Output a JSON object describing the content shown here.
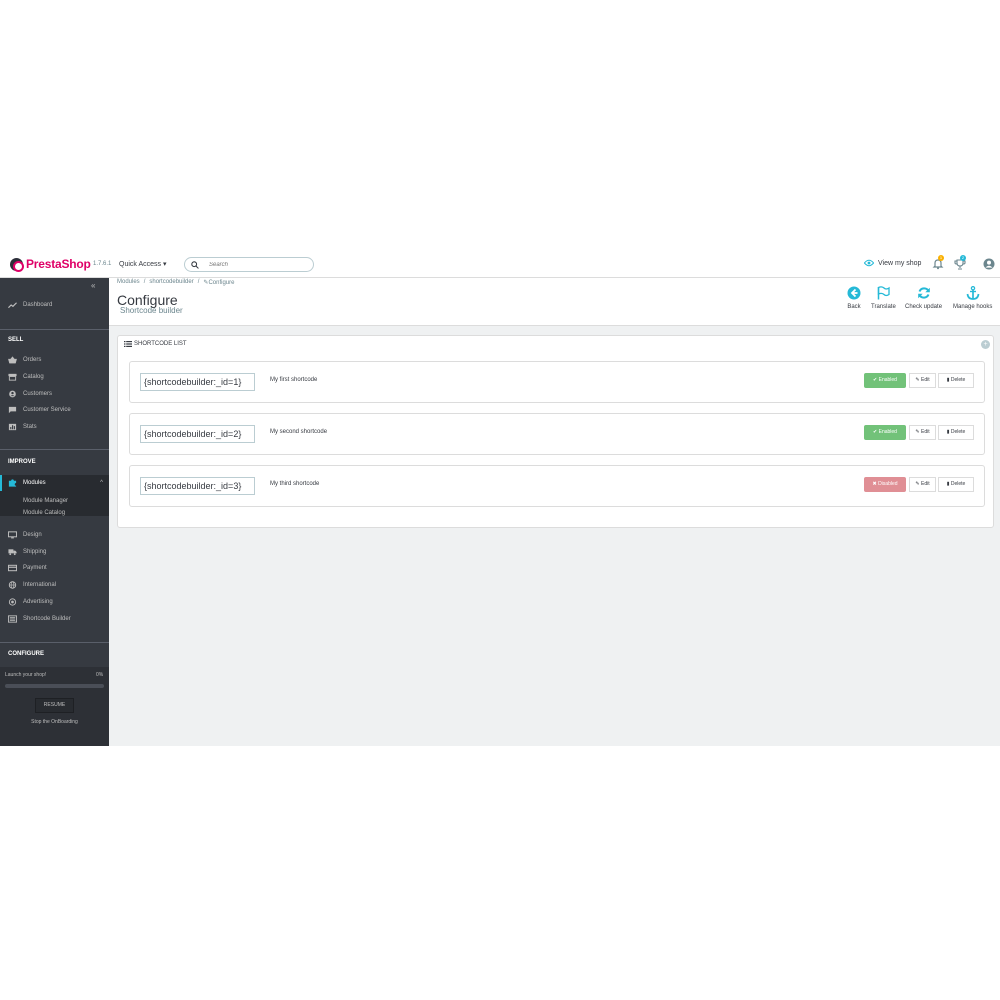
{
  "header": {
    "logo_text": "PrestaShop",
    "version": "1.7.6.1",
    "quick_access": "Quick Access",
    "search_placeholder": "Search",
    "view_shop": "View my shop",
    "notifications_count": "1",
    "orders_count": "2"
  },
  "sidebar": {
    "dashboard": "Dashboard",
    "sections": {
      "sell": "SELL",
      "improve": "IMPROVE",
      "configure": "CONFIGURE"
    },
    "sell_items": [
      "Orders",
      "Catalog",
      "Customers",
      "Customer Service",
      "Stats"
    ],
    "modules": "Modules",
    "module_sub": [
      "Module Manager",
      "Module Catalog"
    ],
    "improve_items": [
      "Design",
      "Shipping",
      "Payment",
      "International",
      "Advertising",
      "Shortcode Builder"
    ],
    "onboarding": {
      "label": "Launch your shop!",
      "percent": "0%",
      "progress": 0,
      "resume": "RESUME",
      "stop": "Stop the OnBoarding"
    }
  },
  "page": {
    "breadcrumb": [
      "Modules",
      "/",
      "shortcodebuilder",
      "/",
      "Configure"
    ],
    "title": "Configure",
    "subtitle": "Shortcode builder",
    "toolbar": [
      "Back",
      "Translate",
      "Check update",
      "Manage hooks"
    ]
  },
  "panel": {
    "heading": "SHORTCODE LIST",
    "rows": [
      {
        "code": "{shortcodebuilder:_id=1}",
        "name": "My first shortcode",
        "status": "Enabled",
        "edit": "Edit",
        "delete": "Delete"
      },
      {
        "code": "{shortcodebuilder:_id=2}",
        "name": "My second shortcode",
        "status": "Enabled",
        "edit": "Edit",
        "delete": "Delete"
      },
      {
        "code": "{shortcodebuilder:_id=3}",
        "name": "My third shortcode",
        "status": "Disabled",
        "edit": "Edit",
        "delete": "Delete"
      }
    ]
  },
  "colors": {
    "accent": "#25b9d7",
    "sidebar_bg": "#363a41",
    "enabled": "#72c279",
    "disabled": "#e08f95",
    "brand": "#df0067"
  }
}
